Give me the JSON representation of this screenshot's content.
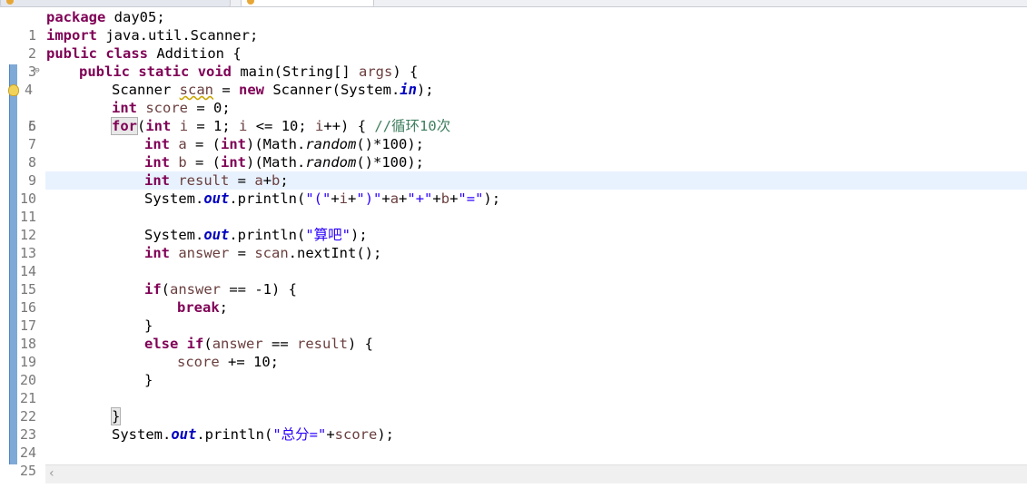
{
  "editor": {
    "icons": {
      "fold": "collapse-minus-icon",
      "bulb": "warning-lightbulb-icon",
      "scroll_left": "chevron-left-icon"
    },
    "lines": [
      {
        "n": "1"
      },
      {
        "n": "2"
      },
      {
        "n": "3"
      },
      {
        "n": "4"
      },
      {
        "n": "5"
      },
      {
        "n": "6"
      },
      {
        "n": "7"
      },
      {
        "n": "8"
      },
      {
        "n": "9"
      },
      {
        "n": "10"
      },
      {
        "n": "11"
      },
      {
        "n": "12"
      },
      {
        "n": "13"
      },
      {
        "n": "14"
      },
      {
        "n": "15"
      },
      {
        "n": "16"
      },
      {
        "n": "17"
      },
      {
        "n": "18"
      },
      {
        "n": "19"
      },
      {
        "n": "20"
      },
      {
        "n": "21"
      },
      {
        "n": "22"
      },
      {
        "n": "23"
      },
      {
        "n": "24"
      },
      {
        "n": "25"
      }
    ],
    "tokens": {
      "l1": [
        "package",
        " day05;"
      ],
      "l2": [
        "import",
        " java.util.Scanner;"
      ],
      "l3": [
        "public",
        " ",
        "class",
        " Addition {"
      ],
      "l4": [
        "public",
        " ",
        "static",
        " ",
        "void",
        " main(String[] ",
        "args",
        ") {"
      ],
      "l5": [
        "Scanner ",
        "scan",
        " = ",
        "new",
        " Scanner(System.",
        "in",
        ");"
      ],
      "l6": [
        "int",
        " ",
        "score",
        " = 0;"
      ],
      "l7": [
        "for",
        "(",
        "int",
        " ",
        "i",
        " = 1; ",
        "i",
        " <= 10; ",
        "i",
        "++) { ",
        "//循环10次"
      ],
      "l8": [
        "int",
        " ",
        "a",
        " = (",
        "int",
        ")(Math.",
        "random",
        "()*100);"
      ],
      "l9": [
        "int",
        " ",
        "b",
        " = (",
        "int",
        ")(Math.",
        "random",
        "()*100);"
      ],
      "l10": [
        "int",
        " ",
        "result",
        " = ",
        "a",
        "+",
        "b",
        ";"
      ],
      "l11": [
        "System.",
        "out",
        ".println(",
        "\"(\"",
        "+",
        "i",
        "+",
        "\")\"",
        "+",
        "a",
        "+",
        "\"+\"",
        "+",
        "b",
        "+",
        "\"=\"",
        ");"
      ],
      "l13": [
        "System.",
        "out",
        ".println(",
        "\"算吧\"",
        ");"
      ],
      "l14": [
        "int",
        " ",
        "answer",
        " = ",
        "scan",
        ".nextInt();"
      ],
      "l16": [
        "if",
        "(",
        "answer",
        " == -1) {"
      ],
      "l17": [
        "break",
        ";"
      ],
      "l18": [
        "}"
      ],
      "l19": [
        "else",
        " ",
        "if",
        "(",
        "answer",
        " == ",
        "result",
        ") {"
      ],
      "l20": [
        "score",
        " += 10;"
      ],
      "l21": [
        "}"
      ],
      "l23": [
        "}"
      ],
      "l24": [
        "System.",
        "out",
        ".println(",
        "\"总分=\"",
        "+",
        "score",
        ");"
      ]
    }
  }
}
